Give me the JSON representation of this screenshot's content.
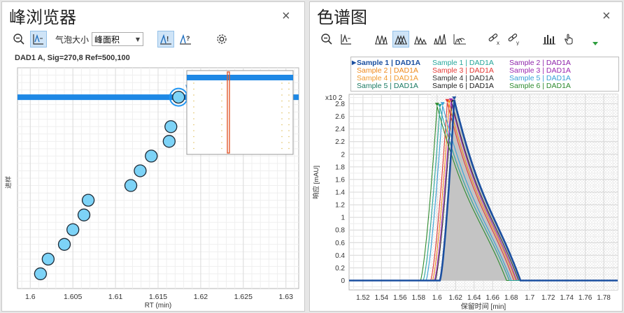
{
  "left": {
    "title": "峰浏览器",
    "close": "×",
    "bubble_size_label": "气泡大小",
    "bubble_size_value": "峰面积",
    "chart_title": "DAD1 A, Sig=270,8 Ref=500,100",
    "icons": [
      "zoom-out-icon",
      "peak-lines-icon",
      "peak-alert-icon",
      "peak-question-icon",
      "settings-gear-icon"
    ]
  },
  "right": {
    "title": "色谱图",
    "close": "×",
    "icons": [
      "zoom-out-icon",
      "peak-lines-icon",
      "overlay-peaks-icon",
      "stack-peaks-icon",
      "offset-peaks-icon",
      "tilt-peaks-icon",
      "waterfall-peaks-icon",
      "link-x-icon",
      "link-y-icon",
      "bar-chart-icon",
      "hand-pointer-icon"
    ],
    "legend": [
      {
        "text": "Sample 1 | DAD1A",
        "color": "#1a4fa0",
        "selected": true
      },
      {
        "text": "Sample 1 | DAD1A",
        "color": "#26a69a"
      },
      {
        "text": "Sample 2 | DAD1A",
        "color": "#8e24aa"
      },
      {
        "text": "Sample 2 | DAD1A",
        "color": "#ef8a1e"
      },
      {
        "text": "Sample 3 | DAD1A",
        "color": "#e53935"
      },
      {
        "text": "Sample 3 | DAD1A",
        "color": "#9c27b0"
      },
      {
        "text": "Sample 4 | DAD1A",
        "color": "#f29a2e"
      },
      {
        "text": "Sample 4 | DAD1A",
        "color": "#333333"
      },
      {
        "text": "Sample 5 | DAD1A",
        "color": "#37a0d8"
      },
      {
        "text": "Sample 5 | DAD1A",
        "color": "#1b7a63"
      },
      {
        "text": "Sample 6 | DAD1A",
        "color": "#222222"
      },
      {
        "text": "Sample 6 | DAD1A",
        "color": "#2e8b2e"
      }
    ]
  },
  "chart_data": [
    {
      "type": "scatter",
      "title": "DAD1 A, Sig=270,8 Ref=500,100",
      "xlabel": "RT (min)",
      "ylabel": "进样",
      "xlim": [
        1.5985,
        1.6315
      ],
      "x_ticks": [
        "1.6",
        "1.605",
        "1.61",
        "1.615",
        "1.62",
        "1.625",
        "1.63"
      ],
      "ylim": [
        0,
        15
      ],
      "grid": true,
      "points": [
        {
          "x": 1.6012,
          "y": 1
        },
        {
          "x": 1.6021,
          "y": 2
        },
        {
          "x": 1.604,
          "y": 3
        },
        {
          "x": 1.605,
          "y": 4
        },
        {
          "x": 1.6063,
          "y": 5
        },
        {
          "x": 1.6068,
          "y": 6
        },
        {
          "x": 1.6118,
          "y": 7
        },
        {
          "x": 1.6129,
          "y": 8
        },
        {
          "x": 1.6142,
          "y": 9
        },
        {
          "x": 1.6163,
          "y": 10
        },
        {
          "x": 1.6165,
          "y": 11
        },
        {
          "x": 1.6174,
          "y": 13
        }
      ],
      "selected_point_index": 11,
      "highlight_band_y": 13
    },
    {
      "type": "line",
      "xlabel": "保留时间 [min]",
      "ylabel": "响应 [mAU]",
      "y_multiplier": "x10 2",
      "xlim": [
        1.505,
        1.795
      ],
      "x_ticks": [
        "1.52",
        "1.54",
        "1.56",
        "1.58",
        "1.6",
        "1.62",
        "1.64",
        "1.66",
        "1.68",
        "1.7",
        "1.72",
        "1.74",
        "1.76",
        "1.78"
      ],
      "ylim": [
        -0.15,
        2.95
      ],
      "y_ticks": [
        "0",
        "0.2",
        "0.4",
        "0.6",
        "0.8",
        "1",
        "1.2",
        "1.4",
        "1.6",
        "1.8",
        "2",
        "2.2",
        "2.4",
        "2.6",
        "2.8"
      ],
      "shaded_region_x": [
        1.593,
        1.795
      ],
      "series": [
        {
          "color": "#1a4fa0",
          "start": 1.603,
          "apex": 1.6185,
          "height": 2.86,
          "end": 1.69
        },
        {
          "color": "#26a69a",
          "start": 1.585,
          "apex": 1.603,
          "height": 2.74,
          "end": 1.678
        },
        {
          "color": "#2e8b2e",
          "start": 1.582,
          "apex": 1.6,
          "height": 2.76,
          "end": 1.675
        },
        {
          "color": "#37a0d8",
          "start": 1.588,
          "apex": 1.606,
          "height": 2.77,
          "end": 1.68
        },
        {
          "color": "#e53935",
          "start": 1.593,
          "apex": 1.611,
          "height": 2.82,
          "end": 1.683
        },
        {
          "color": "#ef8a1e",
          "start": 1.595,
          "apex": 1.613,
          "height": 2.8,
          "end": 1.685
        },
        {
          "color": "#9c27b0",
          "start": 1.597,
          "apex": 1.615,
          "height": 2.83,
          "end": 1.686
        },
        {
          "color": "#333333",
          "start": 1.598,
          "apex": 1.616,
          "height": 2.81,
          "end": 1.688
        }
      ]
    }
  ]
}
